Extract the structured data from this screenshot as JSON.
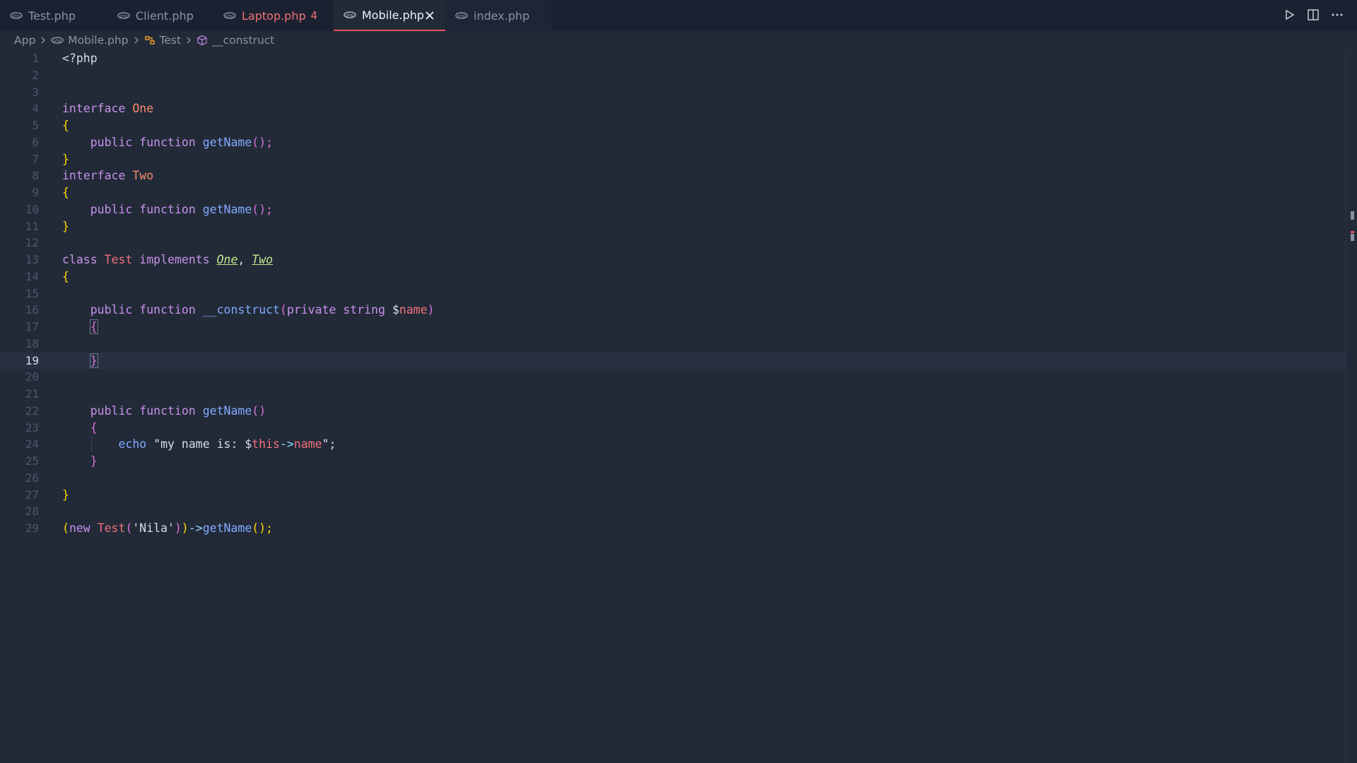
{
  "tabs": [
    {
      "label": "Test.php",
      "state": "normal"
    },
    {
      "label": "Client.php",
      "state": "normal"
    },
    {
      "label": "Laptop.php",
      "state": "modified",
      "badge": "4"
    },
    {
      "label": "Mobile.php",
      "state": "active"
    },
    {
      "label": "index.php",
      "state": "normal"
    }
  ],
  "breadcrumb": {
    "items": [
      "App",
      "Mobile.php",
      "Test",
      "__construct"
    ]
  },
  "editor": {
    "current_line": 19,
    "lines": [
      "1",
      "2",
      "3",
      "4",
      "5",
      "6",
      "7",
      "8",
      "9",
      "10",
      "11",
      "12",
      "13",
      "14",
      "15",
      "16",
      "17",
      "18",
      "19",
      "20",
      "21",
      "22",
      "23",
      "24",
      "25",
      "26",
      "27",
      "28",
      "29"
    ],
    "tokens": {
      "php_open": "<?php",
      "interface": "interface",
      "one": "One",
      "two": "Two",
      "public": "public",
      "function": "function",
      "getName": "getName",
      "parens_semi": "();",
      "class": "class",
      "test": "Test",
      "implements": "implements",
      "construct": "__construct",
      "private": "private",
      "string": "string",
      "dollar": "$",
      "name": "name",
      "echo": "echo",
      "str_open": "\"my name is: ",
      "this": "this",
      "arrow": "->",
      "str_close": "\";",
      "new": "new",
      "nila": "'Nila'",
      "comma": ", ",
      "lbrace": "{",
      "rbrace": "}"
    }
  },
  "colors": {
    "accent": "#e05561",
    "modified": "#f07178"
  }
}
